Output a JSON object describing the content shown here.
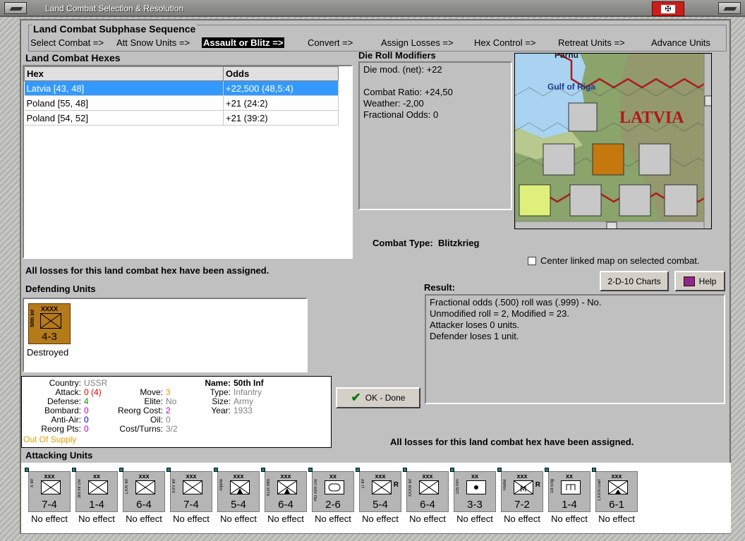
{
  "window": {
    "title": "Land Combat Selection & Resolution"
  },
  "subphase": {
    "heading": "Land Combat Subphase Sequence",
    "steps": [
      "Select Combat =>",
      "Att Snow Units =>",
      "Assault or Blitz =>",
      "Convert =>",
      "Assign Losses =>",
      "Hex Control =>",
      "Retreat Units =>",
      "Advance Units"
    ],
    "active_index": 2
  },
  "hexes": {
    "heading": "Land Combat Hexes",
    "columns": [
      "Hex",
      "Odds"
    ],
    "rows": [
      {
        "hex": "Latvia [43, 48]",
        "odds": "+22,500 (48,5:4)",
        "selected": true
      },
      {
        "hex": "Poland [55, 48]",
        "odds": "+21 (24:2)",
        "selected": false
      },
      {
        "hex": "Poland [54, 52]",
        "odds": "+21 (39:2)",
        "selected": false
      }
    ]
  },
  "modifiers": {
    "heading": "Die Roll Modifiers",
    "lines": [
      "Die mod. (net): +22",
      "",
      "Combat Ratio: +24,50",
      "Weather: -2,00",
      "Fractional Odds: 0"
    ]
  },
  "combat_type": {
    "label": "Combat Type:",
    "value": "Blitzkrieg"
  },
  "map": {
    "labels": {
      "sea": "Gulf of Riga",
      "country": "LATVIA",
      "top": "Parnu"
    },
    "center_checkbox": "Center linked map on selected combat."
  },
  "losses_msg_top": "All losses for this land combat hex have been assigned.",
  "losses_msg_bottom": "All losses for this land combat hex have been assigned.",
  "buttons": {
    "charts": "2-D-10 Charts",
    "help": "Help",
    "ok": "OK - Done"
  },
  "result": {
    "heading": "Result:",
    "lines": [
      "Fractional odds (.500) roll was (.999)  - No.",
      "Unmodified roll = 2, Modified = 23.",
      "Attacker loses 0 units.",
      "Defender loses 1 unit."
    ]
  },
  "defending": {
    "heading": "Defending Units",
    "unit": {
      "size": "XXXX",
      "name": "50th Inf",
      "strength": "4-3",
      "status": "Destroyed",
      "color": "#b57a1a"
    }
  },
  "details": {
    "country_k": "Country:",
    "country_v": "USSR",
    "attack_k": "Attack:",
    "attack_v": "0",
    "attack_v2": "(4)",
    "defense_k": "Defense:",
    "defense_v": "4",
    "bombard_k": "Bombard:",
    "bombard_v": "0",
    "antiair_k": "Anti-Air:",
    "antiair_v": "0",
    "reorg_k": "Reorg Pts:",
    "reorg_v": "0",
    "supply": "Out Of Supply",
    "move_k": "Move:",
    "move_v": "3",
    "elite_k": "Elite:",
    "elite_v": "No",
    "reorgcost_k": "Reorg Cost:",
    "reorgcost_v": "2",
    "oil_k": "Oil:",
    "oil_v": "0",
    "cost_k": "Cost/Turns:",
    "cost_v": "3/2",
    "name_k": "Name:",
    "name_v": "50th Inf",
    "type_k": "Type:",
    "type_v": "Infantry",
    "size_k": "Size:",
    "size_v": "Army",
    "year_k": "Year:",
    "year_v": "1933"
  },
  "attacking": {
    "heading": "Attacking Units",
    "units": [
      {
        "size": "xxx",
        "name": "X Inf",
        "strength": "7-4",
        "status": "No effect",
        "sym": "inf",
        "r": ""
      },
      {
        "size": "xx",
        "name": "3rd Inf Div",
        "strength": "1-4",
        "status": "No effect",
        "sym": "inf",
        "r": ""
      },
      {
        "size": "xxx",
        "name": "LXXI Inf",
        "strength": "6-4",
        "status": "No effect",
        "sym": "inf",
        "r": ""
      },
      {
        "size": "xxx",
        "name": "XXV Inf",
        "strength": "7-4",
        "status": "No effect",
        "sym": "inf",
        "r": ""
      },
      {
        "size": "xxx",
        "name": "Alpine",
        "strength": "5-4",
        "status": "No effect",
        "sym": "mtn",
        "r": ""
      },
      {
        "size": "xxx",
        "name": "XLIX Mtn",
        "strength": "6-4",
        "status": "No effect",
        "sym": "mtn",
        "r": ""
      },
      {
        "size": "xx",
        "name": "HG Arm Div",
        "strength": "2-6",
        "status": "No effect",
        "sym": "arm",
        "r": ""
      },
      {
        "size": "xxx",
        "name": "LI Inf",
        "strength": "5-4",
        "status": "No effect",
        "sym": "inf",
        "r": "R"
      },
      {
        "size": "xxx",
        "name": "XXXIII Inf",
        "strength": "6-4",
        "status": "No effect",
        "sym": "inf",
        "r": ""
      },
      {
        "size": "xx",
        "name": "105 mm",
        "strength": "3-3",
        "status": "No effect",
        "sym": "art",
        "r": ""
      },
      {
        "size": "xxx",
        "name": "Reiter",
        "strength": "7-2",
        "status": "No effect",
        "sym": "mot",
        "r": "R"
      },
      {
        "size": "xx",
        "name": "1st Eng",
        "strength": "1-4",
        "status": "No effect",
        "sym": "eng",
        "r": ""
      },
      {
        "size": "xxx",
        "name": "LXXXI Garr",
        "strength": "6-1",
        "status": "No effect",
        "sym": "garr",
        "r": ""
      }
    ]
  },
  "colors": {
    "selected_row": "#3399ff",
    "attack_red": "#e00000",
    "defense_green": "#00a000",
    "stat_magenta": "#c000c0",
    "supply_orange": "#e0a000",
    "latvia_red": "#b01818"
  },
  "icons": [
    "close-icon",
    "flag-icon",
    "checkmark-icon",
    "help-book-icon"
  ]
}
